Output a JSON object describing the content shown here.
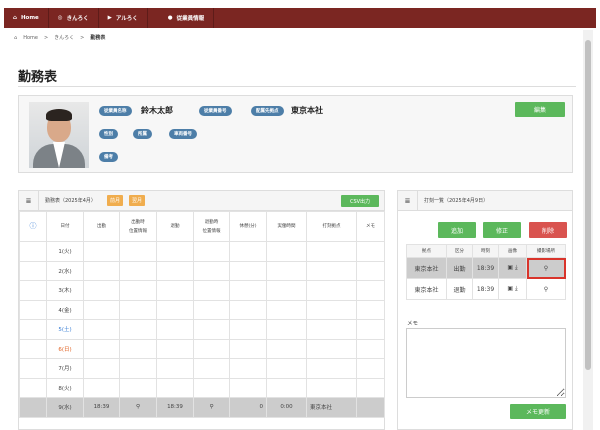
{
  "nav": {
    "items": [
      {
        "icon": "home-icon",
        "label": "Home"
      },
      {
        "icon": "clock-icon",
        "label": "きんろく"
      },
      {
        "icon": "video-icon",
        "label": "アルろく"
      },
      {
        "icon": "user-icon",
        "label": "従業員情報"
      }
    ]
  },
  "breadcrumb": [
    "Home",
    "きんろく",
    "勤務表"
  ],
  "page_title": "勤務表",
  "profile": {
    "labels": {
      "name": "従業員名称",
      "number": "従業員番号",
      "base": "配属先拠点",
      "gender": "性別",
      "dept": "所属",
      "vehicle": "車両番号",
      "note": "備考"
    },
    "name": "鈴木太郎",
    "base": "東京本社",
    "edit_label": "編集"
  },
  "timesheet": {
    "title": "勤務表（2025年4月）",
    "prev": "前月",
    "next": "翌月",
    "csv": "CSV出力",
    "headers": {
      "date": "日付",
      "in": "出勤",
      "in_loc1": "出勤時",
      "in_loc2": "位置情報",
      "out": "退勤",
      "out_loc1": "退勤時",
      "out_loc2": "位置情報",
      "break": "休憩(分)",
      "work": "実働時間",
      "site": "打刻拠点",
      "memo": "メモ"
    },
    "rows": [
      {
        "date": "1(火)",
        "in": "",
        "out": "",
        "break": "",
        "work": "",
        "site": ""
      },
      {
        "date": "2(水)",
        "in": "",
        "out": "",
        "break": "",
        "work": "",
        "site": ""
      },
      {
        "date": "3(木)",
        "in": "",
        "out": "",
        "break": "",
        "work": "",
        "site": ""
      },
      {
        "date": "4(金)",
        "in": "",
        "out": "",
        "break": "",
        "work": "",
        "site": ""
      },
      {
        "date": "5(土)",
        "in": "",
        "out": "",
        "break": "",
        "work": "",
        "site": ""
      },
      {
        "date": "6(日)",
        "in": "",
        "out": "",
        "break": "",
        "work": "",
        "site": ""
      },
      {
        "date": "7(月)",
        "in": "",
        "out": "",
        "break": "",
        "work": "",
        "site": ""
      },
      {
        "date": "8(火)",
        "in": "",
        "out": "",
        "break": "",
        "work": "",
        "site": ""
      },
      {
        "date": "9(水)",
        "in": "18:39",
        "out": "18:39",
        "break": "0",
        "work": "0:00",
        "site": "東京本社"
      }
    ]
  },
  "punches": {
    "title": "打刻一覧（2025年4月9日）",
    "add": "追加",
    "edit": "修正",
    "delete": "削除",
    "headers": [
      "拠点",
      "区分",
      "時刻",
      "画像",
      "撮影場所"
    ],
    "rows": [
      {
        "site": "東京本社",
        "type": "出勤",
        "time": "18:39"
      },
      {
        "site": "東京本社",
        "type": "退勤",
        "time": "18:39"
      }
    ],
    "memo_label": "メモ",
    "memo_value": "",
    "memo_button": "メモ更新"
  },
  "colors": {
    "nav": "#7b2622",
    "badge": "#4d7ea8",
    "green": "#5cb85c",
    "red": "#d9534f",
    "orange": "#f0ad4e",
    "highlight": "#d9342b"
  }
}
